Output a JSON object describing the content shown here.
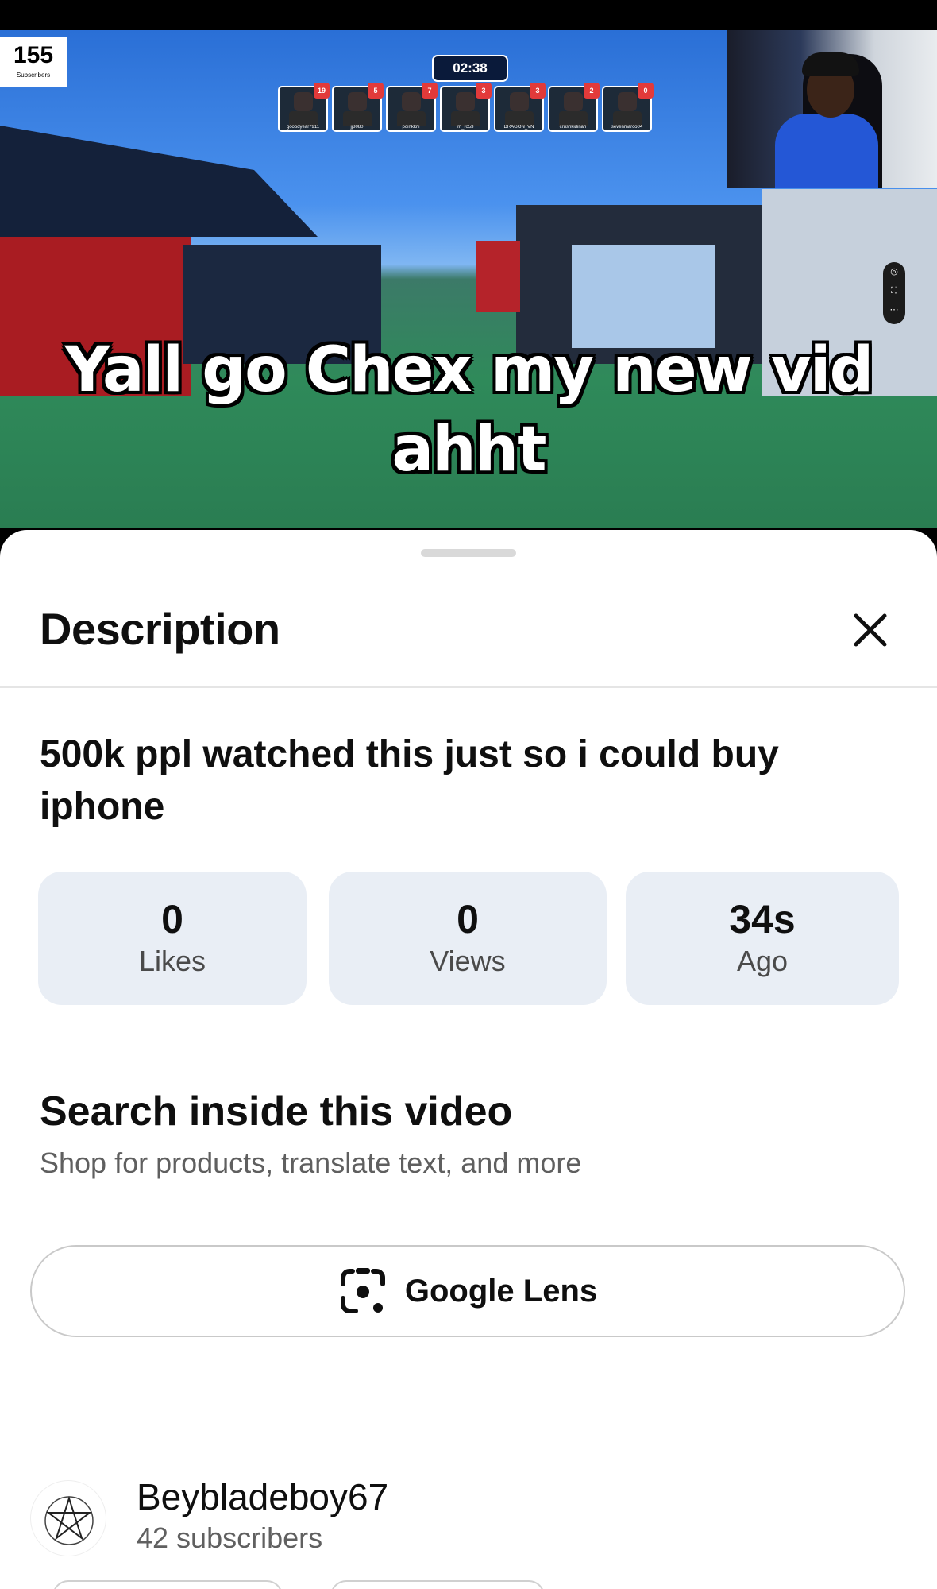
{
  "video": {
    "subscriber_badge_count": "155",
    "subscriber_badge_label": "Subscribers",
    "timer": "02:38",
    "players": [
      {
        "name": "gooodyear7911",
        "kills": "19"
      },
      {
        "name": "jj8080",
        "kills": "5"
      },
      {
        "name": "poinkkni",
        "kills": "7"
      },
      {
        "name": "Im_ro53",
        "kills": "3"
      },
      {
        "name": "DRAGON_VN",
        "kills": "3"
      },
      {
        "name": "crushkidinah",
        "kills": "2"
      },
      {
        "name": "sevenmarco04",
        "kills": "0"
      }
    ],
    "caption": "Yall go Chex my new vid ahht",
    "progress_fraction": 0.03,
    "progress_color": "#ff0033"
  },
  "sheet": {
    "title": "Description",
    "close_icon": "close-icon",
    "video_title": "500k ppl watched this just so i could buy iphone",
    "stats": [
      {
        "value": "0",
        "label": "Likes"
      },
      {
        "value": "0",
        "label": "Views"
      },
      {
        "value": "34s",
        "label": "Ago"
      }
    ],
    "search_section": {
      "title": "Search inside this video",
      "subtitle": "Shop for products, translate text, and more",
      "lens_button_label": "Google Lens",
      "lens_icon": "google-lens-icon"
    },
    "channel": {
      "name": "Beybladeboy67",
      "subscribers": "42 subscribers"
    }
  }
}
